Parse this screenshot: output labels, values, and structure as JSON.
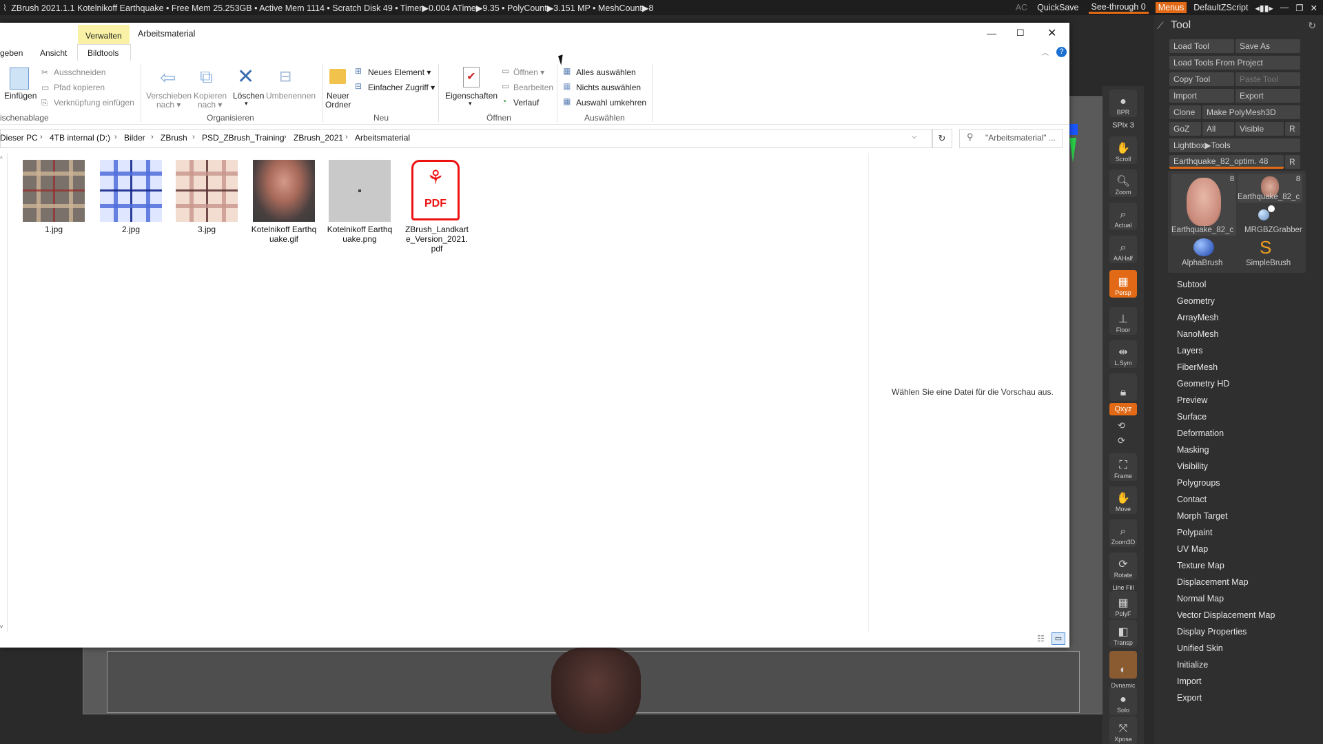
{
  "zbrush": {
    "title_text": "ZBrush 2021.1.1   Kotelnikoff Earthquake    • Free Mem 25.253GB • Active Mem 1114 • Scratch Disk 49 •  Timer▶0.004 ATime▶9.35 • PolyCount▶3.151 MP  • MeshCount▶8",
    "ac": "AC",
    "quicksave": "QuickSave",
    "seethrough": "See-through  0",
    "menus": "Menus",
    "defaultzscript": "DefaultZScript"
  },
  "shelf": [
    {
      "label": "BPR"
    },
    {
      "label": "SPix 3"
    },
    {
      "label": "Scroll"
    },
    {
      "label": "Zoom"
    },
    {
      "label": "Actual"
    },
    {
      "label": "AAHalf"
    },
    {
      "label": "Persp"
    },
    {
      "label": "Floor"
    },
    {
      "label": "L.Sym"
    },
    {
      "label": "Qxyz"
    },
    {
      "label": "Frame"
    },
    {
      "label": "Move"
    },
    {
      "label": "Zoom3D"
    },
    {
      "label": "Rotate"
    },
    {
      "label": "Line Fill"
    },
    {
      "label": "PolyF"
    },
    {
      "label": "Transp"
    },
    {
      "label": "Dynamic"
    },
    {
      "label": "Solo"
    },
    {
      "label": "Xpose"
    }
  ],
  "tool": {
    "title": "Tool",
    "load_tool": "Load Tool",
    "save_as": "Save As",
    "load_from_project": "Load Tools From Project",
    "copy_tool": "Copy Tool",
    "paste_tool": "Paste Tool",
    "import": "Import",
    "export": "Export",
    "clone": "Clone",
    "make_polymesh": "Make PolyMesh3D",
    "goz": "GoZ",
    "all": "All",
    "visible": "Visible",
    "r": "R",
    "lightbox": "Lightbox▶Tools",
    "slider": "Earthquake_82_optim. 48",
    "thumbs": [
      {
        "label": "Earthquake_82_c",
        "count": "8"
      },
      {
        "label": "Earthquake_82_c",
        "count": "8"
      },
      {
        "label": "MRGBZGrabber",
        "count": ""
      },
      {
        "label": "AlphaBrush",
        "count": ""
      },
      {
        "label": "SimpleBrush",
        "count": ""
      }
    ],
    "subpalettes": [
      "Subtool",
      "Geometry",
      "ArrayMesh",
      "NanoMesh",
      "Layers",
      "FiberMesh",
      "Geometry HD",
      "Preview",
      "Surface",
      "Deformation",
      "Masking",
      "Visibility",
      "Polygroups",
      "Contact",
      "Morph Target",
      "Polypaint",
      "UV Map",
      "Texture Map",
      "Displacement Map",
      "Normal Map",
      "Vector Displacement Map",
      "Display Properties",
      "Unified Skin",
      "Initialize",
      "Import",
      "Export"
    ]
  },
  "explorer": {
    "context_tab": "Verwalten",
    "window_title": "Arbeitsmaterial",
    "tabs": [
      "geben",
      "Ansicht",
      "Bildtools"
    ],
    "ribbon": {
      "einfuegen": "Einfügen",
      "ausschneiden": "Ausschneiden",
      "pfad_kopieren": "Pfad kopieren",
      "verknuepfung": "Verknüpfung einfügen",
      "zwischenablage": "ischenablage",
      "verschieben": "Verschieben",
      "nach1": "nach ▾",
      "kopieren": "Kopieren",
      "nach2": "nach ▾",
      "loeschen": "Löschen",
      "umbenennen": "Umbenennen",
      "organisieren": "Organisieren",
      "neuer": "Neuer",
      "ordner": "Ordner",
      "neues_element": "Neues Element ▾",
      "einfacher_zugriff": "Einfacher Zugriff ▾",
      "neu": "Neu",
      "eigenschaften": "Eigenschaften",
      "oeffnen_btn": "Öffnen ▾",
      "bearbeiten": "Bearbeiten",
      "verlauf": "Verlauf",
      "oeffnen": "Öffnen",
      "alles_auswaehlen": "Alles auswählen",
      "nichts_auswaehlen": "Nichts auswählen",
      "auswahl_umkehren": "Auswahl umkehren",
      "auswaehlen": "Auswählen"
    },
    "breadcrumbs": [
      "Dieser PC",
      "4TB internal (D:)",
      "Bilder",
      "ZBrush",
      "PSD_ZBrush_Training",
      "ZBrush_2021",
      "Arbeitsmaterial"
    ],
    "search_placeholder": "\"Arbeitsmaterial\" ...",
    "files": [
      {
        "name": "1.jpg",
        "kind": "plaid-gray"
      },
      {
        "name": "2.jpg",
        "kind": "plaid-blue"
      },
      {
        "name": "3.jpg",
        "kind": "plaid-peach"
      },
      {
        "name": "Kotelnikoff Earthquake.gif",
        "kind": "character"
      },
      {
        "name": "Kotelnikoff Earthquake.png",
        "kind": "gray"
      },
      {
        "name": "ZBrush_Landkarte_Version_2021.pdf",
        "kind": "pdf"
      }
    ],
    "pdf_text": "PDF",
    "preview_text": "Wählen Sie eine Datei für die Vorschau aus."
  }
}
